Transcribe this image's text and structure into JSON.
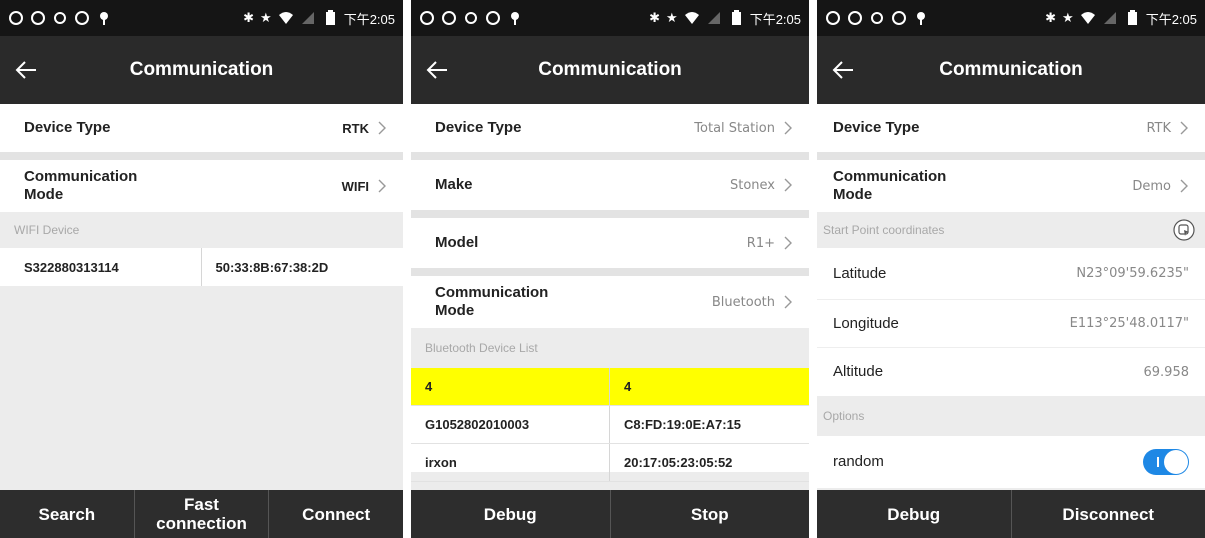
{
  "status": {
    "time": "下午2:05"
  },
  "p1": {
    "title": "Communication",
    "device_type": {
      "label": "Device Type",
      "value": "RTK"
    },
    "comm_mode": {
      "label": "Communication\nMode",
      "value": "WIFI"
    },
    "section": "WIFI Device",
    "devices": [
      {
        "name": "S322880313114",
        "address": "50:33:8B:67:38:2D"
      }
    ],
    "buttons": {
      "search": "Search",
      "fast": "Fast\nconnection",
      "connect": "Connect"
    }
  },
  "p2": {
    "title": "Communication",
    "device_type": {
      "label": "Device Type",
      "value": "Total Station"
    },
    "make": {
      "label": "Make",
      "value": "Stonex"
    },
    "model": {
      "label": "Model",
      "value": "R1+"
    },
    "comm_mode": {
      "label": "Communication\nMode",
      "value": "Bluetooth"
    },
    "section": "Bluetooth Device List",
    "devices": [
      {
        "name": "4",
        "address": "4",
        "selected": true
      },
      {
        "name": "G1052802010003",
        "address": "C8:FD:19:0E:A7:15",
        "selected": false
      },
      {
        "name": "irxon",
        "address": "20:17:05:23:05:52",
        "selected": false
      }
    ],
    "buttons": {
      "debug": "Debug",
      "stop": "Stop"
    }
  },
  "p3": {
    "title": "Communication",
    "device_type": {
      "label": "Device Type",
      "value": "RTK"
    },
    "comm_mode": {
      "label": "Communication\nMode",
      "value": "Demo"
    },
    "section_coords": "Start Point coordinates",
    "latitude": {
      "label": "Latitude",
      "value": "N23°09'59.6235\""
    },
    "longitude": {
      "label": "Longitude",
      "value": "E113°25'48.0117\""
    },
    "altitude": {
      "label": "Altitude",
      "value": "69.958"
    },
    "section_options": "Options",
    "random": {
      "label": "random",
      "on": true
    },
    "buttons": {
      "debug": "Debug",
      "disconnect": "Disconnect"
    }
  },
  "colors": {
    "accent": "#1e88e5",
    "selected_row": "#ffff00",
    "bar": "#2a2a2a"
  },
  "icons": [
    "back-arrow-icon",
    "chevron-right-icon",
    "locate-icon",
    "bluetooth-icon",
    "star-icon",
    "wifi-icon",
    "battery-icon"
  ]
}
